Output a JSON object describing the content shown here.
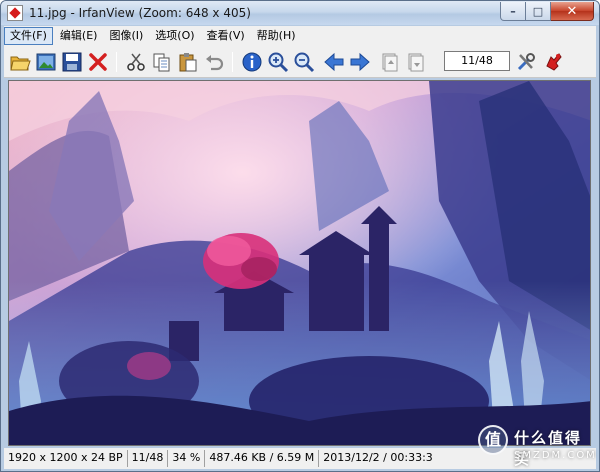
{
  "window": {
    "title": "11.jpg - IrfanView (Zoom: 648 x 405)",
    "buttons": {
      "minimize": "–",
      "maximize": "□",
      "close": "✕"
    }
  },
  "menu": {
    "items": [
      {
        "label": "文件(F)"
      },
      {
        "label": "编辑(E)"
      },
      {
        "label": "图像(I)"
      },
      {
        "label": "选项(O)"
      },
      {
        "label": "查看(V)"
      },
      {
        "label": "帮助(H)"
      }
    ]
  },
  "toolbar": {
    "icons": [
      "open-folder-icon",
      "thumbnails-icon",
      "save-icon",
      "delete-icon",
      "cut-icon",
      "copy-icon",
      "paste-icon",
      "undo-icon",
      "info-icon",
      "zoom-in-icon",
      "zoom-out-icon",
      "previous-icon",
      "next-icon",
      "previous-page-icon",
      "next-page-icon",
      "properties-icon",
      "exit-icon"
    ],
    "page_indicator": "11/48"
  },
  "status": {
    "dimensions": "1920 x 1200 x 24 BP",
    "index": "11/48",
    "zoom": "34 %",
    "size": "487.46 KB / 6.59 M",
    "datetime": "2013/12/2 / 00:33:3"
  },
  "watermark": {
    "symbol": "值",
    "cn_text": "什么值得买",
    "en_text": "SMZDM.COM"
  },
  "colors": {
    "titlebar": "#c7d8ec",
    "close_button": "#c7432a",
    "chrome": "#f0f0f0"
  }
}
